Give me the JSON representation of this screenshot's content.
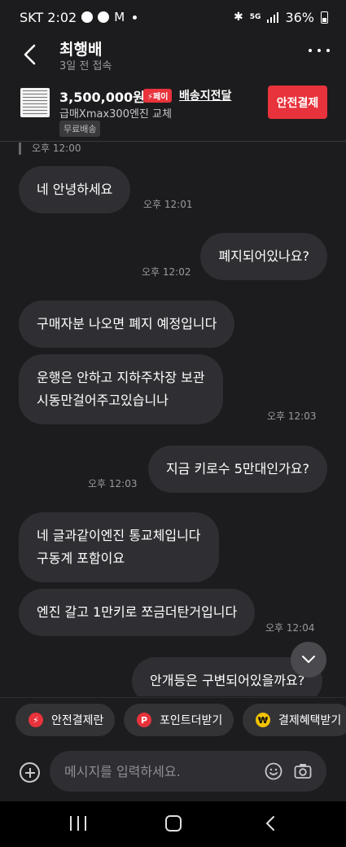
{
  "status": {
    "carrier_time": "SKT 2:02",
    "network": "5G",
    "battery": "36%",
    "icons": [
      "talk-icon",
      "message-icon",
      "mail-icon",
      "bluetooth-icon",
      "wifi-icon",
      "signal-icon",
      "battery-icon"
    ]
  },
  "header": {
    "name": "최행배",
    "last_seen": "3일 전 접속"
  },
  "product": {
    "price": "3,500,000원",
    "pay_badge": "페이",
    "delivery": "배송지전달",
    "name": "급매Xmax300엔진 교체",
    "tag": "무료배송",
    "safe_pay": "안전결제"
  },
  "messages": [
    {
      "side": "time",
      "time": "오후 12:00"
    },
    {
      "side": "left",
      "lines": [
        "네 안녕하세요"
      ],
      "time": "오후 12:01"
    },
    {
      "side": "right",
      "lines": [
        "폐지되어있나요?"
      ],
      "time": "오후 12:02"
    },
    {
      "side": "left",
      "lines": [
        "구매자분 나오면 폐지 예정입니다"
      ],
      "time": ""
    },
    {
      "side": "left",
      "lines": [
        "운행은 안하고 지하주차장 보관",
        "시동만걸어주고있습니나"
      ],
      "time": "오후 12:03"
    },
    {
      "side": "right",
      "lines": [
        "지금 키로수 5만대인가요?"
      ],
      "time": "오후 12:03"
    },
    {
      "side": "left",
      "lines": [
        "네 글과같이엔진 통교체입니다",
        "구동계 포함이요"
      ],
      "time": ""
    },
    {
      "side": "left",
      "lines": [
        "엔진 갈고 1만키로 쪼금더탄거입니다"
      ],
      "time": "오후 12:04"
    },
    {
      "side": "right",
      "lines": [
        "안개등은 구변되어있을까요?"
      ],
      "time": ""
    }
  ],
  "quick_actions": [
    {
      "label": "안전결제란",
      "icon": "bolt-icon",
      "color": "#e8333c"
    },
    {
      "label": "포인트더받기",
      "icon": "p-point-icon",
      "color": "#e8333c"
    },
    {
      "label": "결제혜택받기",
      "icon": "won-icon",
      "color": "#f2c200"
    }
  ],
  "input": {
    "placeholder": "메시지를 입력하세요."
  }
}
